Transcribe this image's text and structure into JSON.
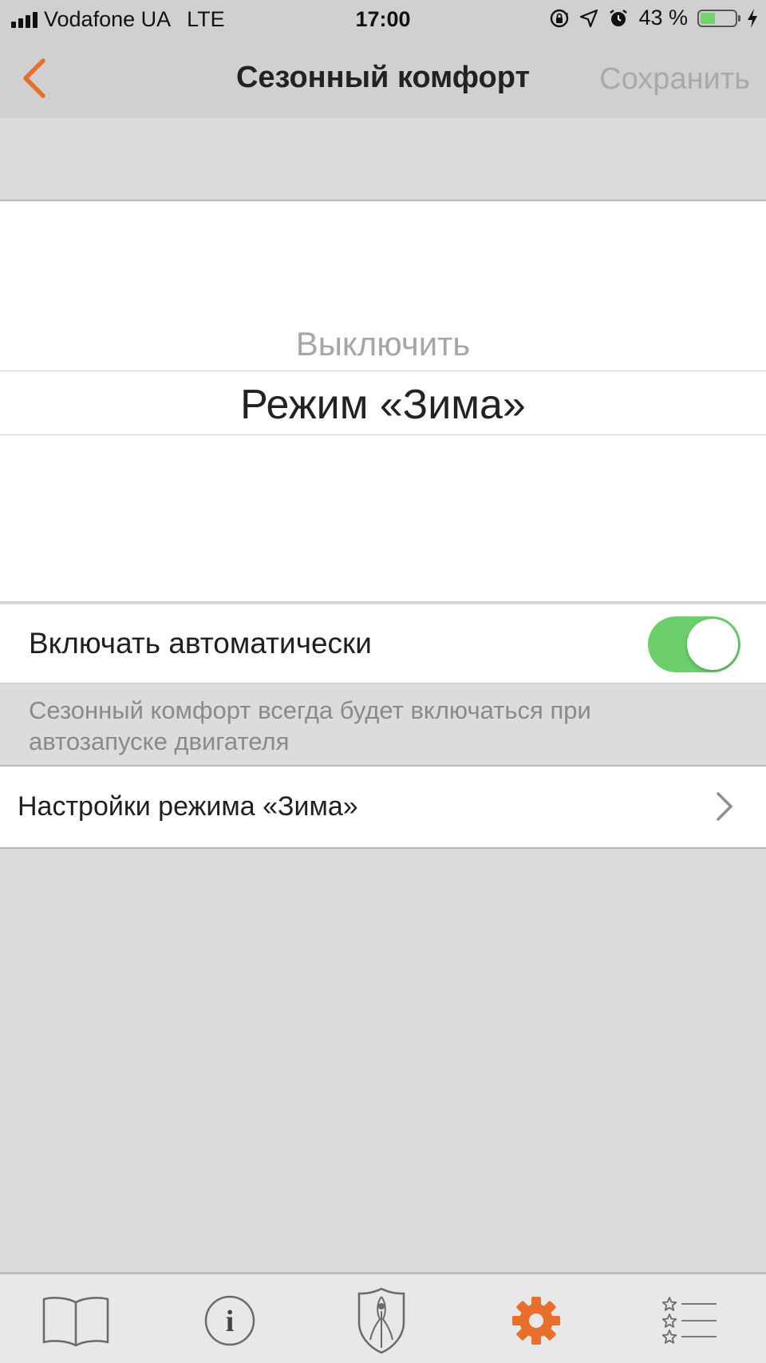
{
  "status_bar": {
    "carrier": "Vodafone UA",
    "network": "LTE",
    "time": "17:00",
    "battery": "43 %",
    "battery_level": 0.43,
    "icons": [
      "signal-icon",
      "rotation-lock-icon",
      "location-icon",
      "alarm-icon",
      "battery-icon",
      "charging-icon"
    ]
  },
  "nav": {
    "back_icon": "chevron-left-icon",
    "title": "Сезонный комфорт",
    "save_label": "Сохранить"
  },
  "picker": {
    "options": [
      "Выключить",
      "Режим «Зима»"
    ],
    "selected": "Режим «Зима»"
  },
  "auto_toggle": {
    "label": "Включать автоматически",
    "on": true,
    "footer": "Сезонный комфорт всегда будет включаться при автозапуске двигателя"
  },
  "settings_row": {
    "label": "Настройки режима «Зима»",
    "icon": "chevron-right-icon"
  },
  "tab_bar": {
    "tabs": [
      {
        "icon": "book-icon",
        "active": false
      },
      {
        "icon": "info-icon",
        "active": false
      },
      {
        "icon": "shield-logo-icon",
        "active": false
      },
      {
        "icon": "gear-icon",
        "active": true
      },
      {
        "icon": "star-list-icon",
        "active": false
      }
    ],
    "info_glyph": "i"
  },
  "colors": {
    "accent": "#e86e2c",
    "toggle_on": "#6ccf6b",
    "inactive_tab": "#6a6a6a",
    "background": "#dcdcdc"
  }
}
